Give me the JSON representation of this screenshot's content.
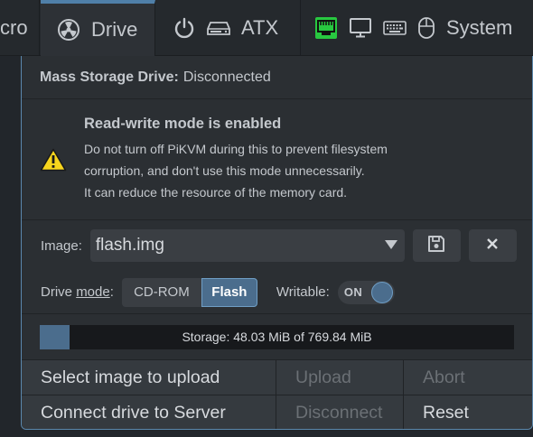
{
  "navbar": {
    "macro_label": "cro",
    "drive_label": "Drive",
    "atx_label": "ATX",
    "system_label": "System"
  },
  "panel": {
    "title_prefix": "Mass Storage Drive:",
    "title_status": "Disconnected",
    "warning": {
      "heading": "Read-write mode is enabled",
      "lines": [
        "Do not turn off PiKVM during this to prevent filesystem",
        "corruption, and don't use this mode unnecessarily.",
        "It can reduce the resource of the memory card."
      ]
    },
    "image_label": "Image:",
    "image_selected": "flash.img",
    "drive_label": "Drive",
    "drive_label_mode": "mode",
    "drive_label_colon": ":",
    "mode_options": [
      "CD-ROM",
      "Flash"
    ],
    "mode_selected": "Flash",
    "writable_label": "Writable:",
    "writable_state": "ON",
    "storage": {
      "text": "Storage: 48.03 MiB of 769.84 MiB",
      "used_mib": 48.03,
      "total_mib": 769.84
    },
    "buttons": {
      "select_image": "Select image to upload",
      "upload": "Upload",
      "abort": "Abort",
      "connect": "Connect drive to Server",
      "disconnect": "Disconnect",
      "reset": "Reset"
    }
  },
  "colors": {
    "accent": "#4b6d8d",
    "accent_border": "#6f9ec5",
    "warning_yellow": "#f7d51d",
    "ethernet_green": "#28c840"
  }
}
